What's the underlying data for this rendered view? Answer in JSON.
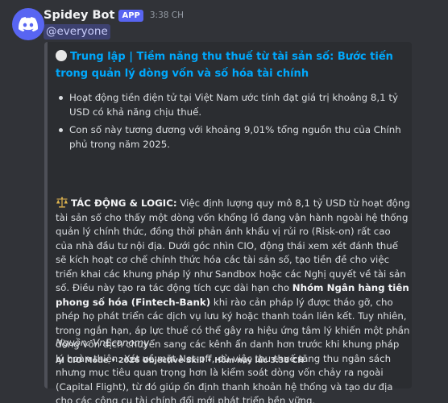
{
  "message": {
    "username": "Spidey Bot",
    "badge": "APP",
    "timestamp": "3:38 CH",
    "mention": "@everyone"
  },
  "embed": {
    "accent_color": "#4e5058",
    "title": "Trung lập | Tiềm năng thu thuế từ tài sản số: Bước tiến trong quản lý dòng vốn và số hóa tài chính",
    "bullets": [
      "Hoạt động tiền điện tử tại Việt Nam ước tính đạt giá trị khoảng 8,1 tỷ USD có khả năng chịu thuế.",
      "Con số này tương đương với khoảng 9,01% tổng nguồn thu của Chính phủ trong năm 2025."
    ],
    "analysis": {
      "heading": "TÁC ĐỘNG & LOGIC:",
      "text1": " Việc định lượng quy mô 8,1 tỷ USD từ hoạt động tài sản số cho thấy một dòng vốn khổng lồ đang vận hành ngoài hệ thống quản lý chính thức, đồng thời phản ánh khẩu vị rủi ro (Risk-on) rất cao của nhà đầu tư nội địa. Dưới góc nhìn CIO, động thái xem xét đánh thuế sẽ kích hoạt cơ chế chính thức hóa các tài sản số, tạo tiền đề cho việc triển khai các khung pháp lý như Sandbox hoặc các Nghị quyết về tài sản số. Điều này tạo ra tác động tích cực dài hạn cho ",
      "bold2": "Nhóm Ngân hàng tiên phong số hóa (Fintech-Bank)",
      "text2": " khi rào cản pháp lý được tháo gỡ, cho phép họ phát triển các dịch vụ lưu ký hoặc thanh toán liên kết. Tuy nhiên, trong ngắn hạn, áp lực thuế có thể gây ra hiệu ứng tâm lý khiến một phần dòng vốn dịch chuyển sang các kênh ẩn danh hơn trước khi khung pháp lý hoàn thiện. Xét về mặt Net-off, dù việc thu thuế tăng thu ngân sách nhưng mục tiêu quan trọng hơn là kiểm soát dòng vốn chảy ra ngoài (Capital Flight), từ đó giúp ổn định thanh khoản hệ thống và tạo dư địa cho các công cụ tài chính đổi mới phát triển bền vững."
    },
    "source": "Nguồn: VnEconomy",
    "footer": "AI CIO Mode • 2026 Objective Skill • Hôm nay lúc 3:38 CH"
  },
  "colors": {
    "background": "#313338",
    "embed_bg": "#2b2d31",
    "link": "#00a8fc",
    "badge": "#5865f2"
  },
  "icons": {
    "avatar": "discord-logo-icon",
    "title_marker": "white-circle-icon",
    "analysis_marker": "balance-scale-icon"
  }
}
